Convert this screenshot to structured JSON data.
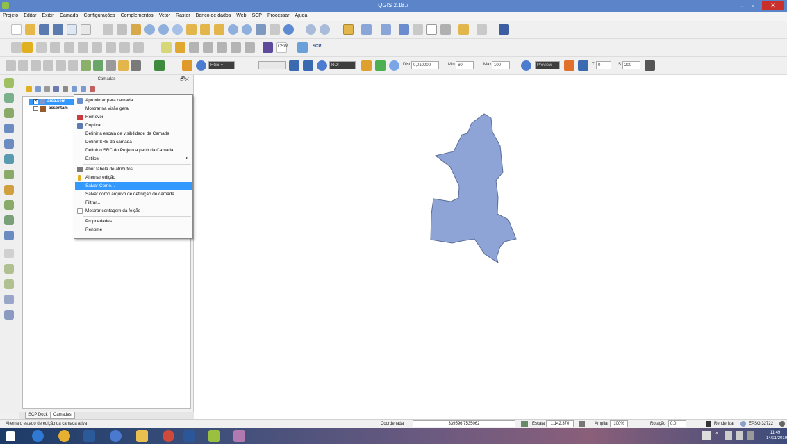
{
  "window": {
    "title": "QGIS 2.18.7",
    "controls": {
      "minimize": "–",
      "maximize": "▫",
      "close": "✕"
    }
  },
  "menubar": {
    "items": [
      "Projeto",
      "Editar",
      "Exibir",
      "Camada",
      "Configurações",
      "Complementos",
      "Vetor",
      "Raster",
      "Banco de dados",
      "Web",
      "SCP",
      "Processar",
      "Ajuda"
    ]
  },
  "toolbar3": {
    "rgb_combo": "RGB =",
    "roi_combo": "ROI",
    "dist_label": "Dist",
    "dist_value": "0,010000",
    "min_label": "Min",
    "min_value": "60",
    "max_label": "Max",
    "max_value": "100",
    "preview_label": "Preview",
    "t_label": "T",
    "t_value": "0",
    "s_label": "S",
    "s_value": "200"
  },
  "toolbar2": {
    "csw_label": "CSW",
    "scp_label": "SCP"
  },
  "layers_panel": {
    "title": "Camadas",
    "buttons": "🗗✕",
    "layers": [
      {
        "checked": "✕",
        "name": "area.sem",
        "color": "#7c98cf"
      },
      {
        "name": "assentam",
        "color": "#9a5a2a"
      }
    ]
  },
  "context_menu": {
    "items": [
      {
        "label": "Aproximar para camada",
        "icon": "#6a8fc9"
      },
      {
        "label": "Mostrar na visão geral",
        "icon": ""
      },
      {
        "label": "Remover",
        "icon": "#cc3b3b"
      },
      {
        "label": "Duplicar",
        "icon": "#5a7ab0"
      },
      {
        "label": "Definir a escala de visibilidade da Camada",
        "icon": ""
      },
      {
        "label": "Definir SRS da camada",
        "icon": ""
      },
      {
        "label": "Definir o SRC do Projeto a partir da Camada",
        "icon": ""
      },
      {
        "label": "Estilos",
        "icon": "",
        "submenu": "▸"
      },
      {
        "label": "Abrir tabela de atributos",
        "icon": "#7a7a7a"
      },
      {
        "label": "Alternar edição",
        "icon": "#e0b020"
      },
      {
        "label": "Salvar Como...",
        "icon": "",
        "highlighted": true
      },
      {
        "label": "Salvar como arquivo de definição de camada...",
        "icon": ""
      },
      {
        "label": "Filtrar...",
        "icon": ""
      },
      {
        "label": "Mostrar contagem da feição",
        "icon": "#dddddd"
      },
      {
        "label": "Propriedades",
        "icon": ""
      },
      {
        "label": "Renome",
        "icon": ""
      }
    ]
  },
  "dock_tabs": [
    "SCP Dock",
    "Camadas"
  ],
  "map": {
    "polygon_fill": "#8ea4d6",
    "polygon_stroke": "#5b6c96"
  },
  "statusbar": {
    "message": "Alterna o estado de edição da camada ativa",
    "coord_label": "Coordenada",
    "coord_value": "339596,7535062",
    "scale_label": "Escala",
    "scale_value": "1:142.370",
    "zoom_label": "Ampliar",
    "zoom_value": "100%",
    "rotation_label": "Rotação",
    "rotation_value": "0,0",
    "render_label": "Renderizar",
    "crs_label": "EPSG:32722"
  },
  "taskbar": {
    "time": "11:49",
    "date": "14/01/2019"
  },
  "colors": {
    "titlebar": "#5b84c9",
    "selection": "#3399ff",
    "close": "#c9302c"
  }
}
